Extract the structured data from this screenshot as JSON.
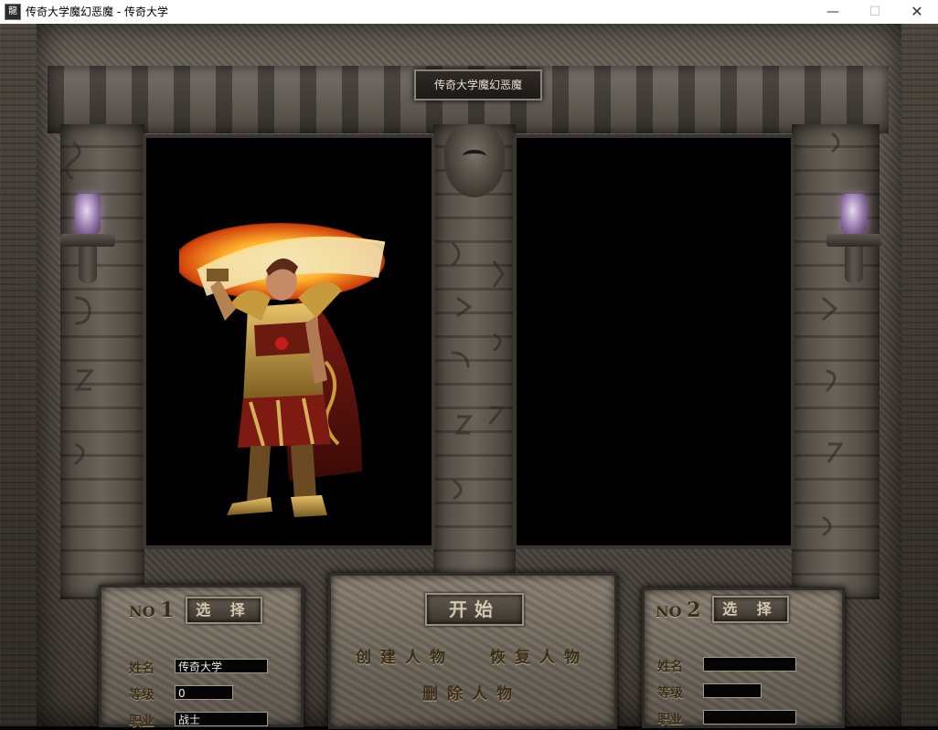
{
  "window": {
    "title": "传奇大学魔幻恶魔 - 传奇大学",
    "icon_text": "龍",
    "minimize_glyph": "—",
    "maximize_glyph": "☐",
    "close_glyph": "✕"
  },
  "server_plate": "传奇大学魔幻恶魔",
  "slot1": {
    "no_prefix": "NO",
    "no_number": "1",
    "select_label": "选 择",
    "name_label": "姓名",
    "name_value": "传奇大学",
    "level_label": "等级",
    "level_value": "0",
    "job_label": "职业",
    "job_value": "战士"
  },
  "slot2": {
    "no_prefix": "NO",
    "no_number": "2",
    "select_label": "选 择",
    "name_label": "姓名",
    "name_value": "",
    "level_label": "等级",
    "level_value": "",
    "job_label": "职业",
    "job_value": ""
  },
  "actions": {
    "start": "开始",
    "create": "创建人物",
    "restore": "恢复人物",
    "delete": "删除人物"
  }
}
